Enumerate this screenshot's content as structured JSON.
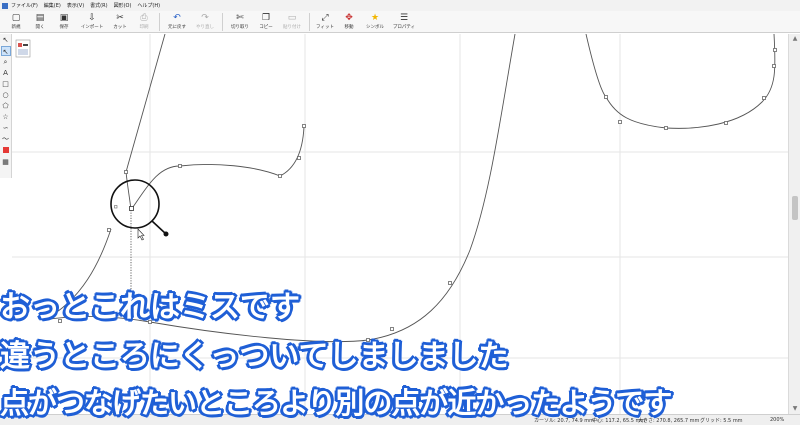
{
  "menubar": {
    "items": [
      "ファイル(F)",
      "編集(E)",
      "表示(V)",
      "書式(R)",
      "図形(O)",
      "ヘルプ(H)"
    ]
  },
  "toolbar": {
    "buttons": [
      {
        "label": "新規",
        "icon": "new-file-icon",
        "glyph": "▢"
      },
      {
        "label": "開く",
        "icon": "open-folder-icon",
        "glyph": "▤"
      },
      {
        "label": "保存",
        "icon": "save-icon",
        "glyph": "▣"
      },
      {
        "label": "インポート",
        "icon": "import-icon",
        "glyph": "⇩"
      },
      {
        "label": "カット",
        "icon": "cut-icon",
        "glyph": "✂"
      },
      {
        "label": "印刷",
        "icon": "print-icon",
        "glyph": "⎙"
      },
      {
        "label": "元に戻す",
        "icon": "undo-icon",
        "glyph": "↶"
      },
      {
        "label": "やり直し",
        "icon": "redo-icon",
        "glyph": "↷"
      },
      {
        "label": "切り取り",
        "icon": "cut-shape-icon",
        "glyph": "✄"
      },
      {
        "label": "コピー",
        "icon": "copy-icon",
        "glyph": "❐"
      },
      {
        "label": "貼り付け",
        "icon": "paste-icon",
        "glyph": "▭"
      },
      {
        "label": "フィット",
        "icon": "fit-icon",
        "glyph": "⤢"
      },
      {
        "label": "移動",
        "icon": "move-icon",
        "glyph": "✥"
      },
      {
        "label": "シンボル",
        "icon": "symbol-star-icon",
        "glyph": "★"
      },
      {
        "label": "プロパティ",
        "icon": "properties-icon",
        "glyph": "☰"
      }
    ]
  },
  "left_tools": [
    {
      "name": "select-arrow-icon",
      "glyph": "↖"
    },
    {
      "name": "node-select-icon",
      "glyph": "↖"
    },
    {
      "name": "zoom-icon",
      "glyph": "⌕"
    },
    {
      "name": "text-tool-icon",
      "glyph": "A"
    },
    {
      "name": "rectangle-tool-icon",
      "glyph": "□"
    },
    {
      "name": "ellipse-tool-icon",
      "glyph": "○"
    },
    {
      "name": "polygon-tool-icon",
      "glyph": "⬠"
    },
    {
      "name": "star-tool-icon",
      "glyph": "☆"
    },
    {
      "name": "curve-tool-icon",
      "glyph": "∽"
    },
    {
      "name": "freehand-tool-icon",
      "glyph": "〜"
    },
    {
      "name": "color-swatch-icon",
      "glyph": ""
    },
    {
      "name": "layers-icon",
      "glyph": "▦"
    }
  ],
  "statusbar": {
    "cursor": "カーソル: 20.7, 74.9 mm",
    "center": "中心: 117.2, 65.5 mm",
    "size": "大きさ: 270.8, 265.7 mm",
    "grid": "グリッド: 5.5 mm",
    "zoom": "200%"
  },
  "captions": [
    "おっとこれはミスです",
    "違うところにくっついてしましました",
    "点がつなげたいところより別の点が近かったようです"
  ],
  "colors": {
    "caption_fill": "#ffffff",
    "caption_outline": "#1f5fd6",
    "path_stroke": "#555555",
    "node": "#666666"
  }
}
